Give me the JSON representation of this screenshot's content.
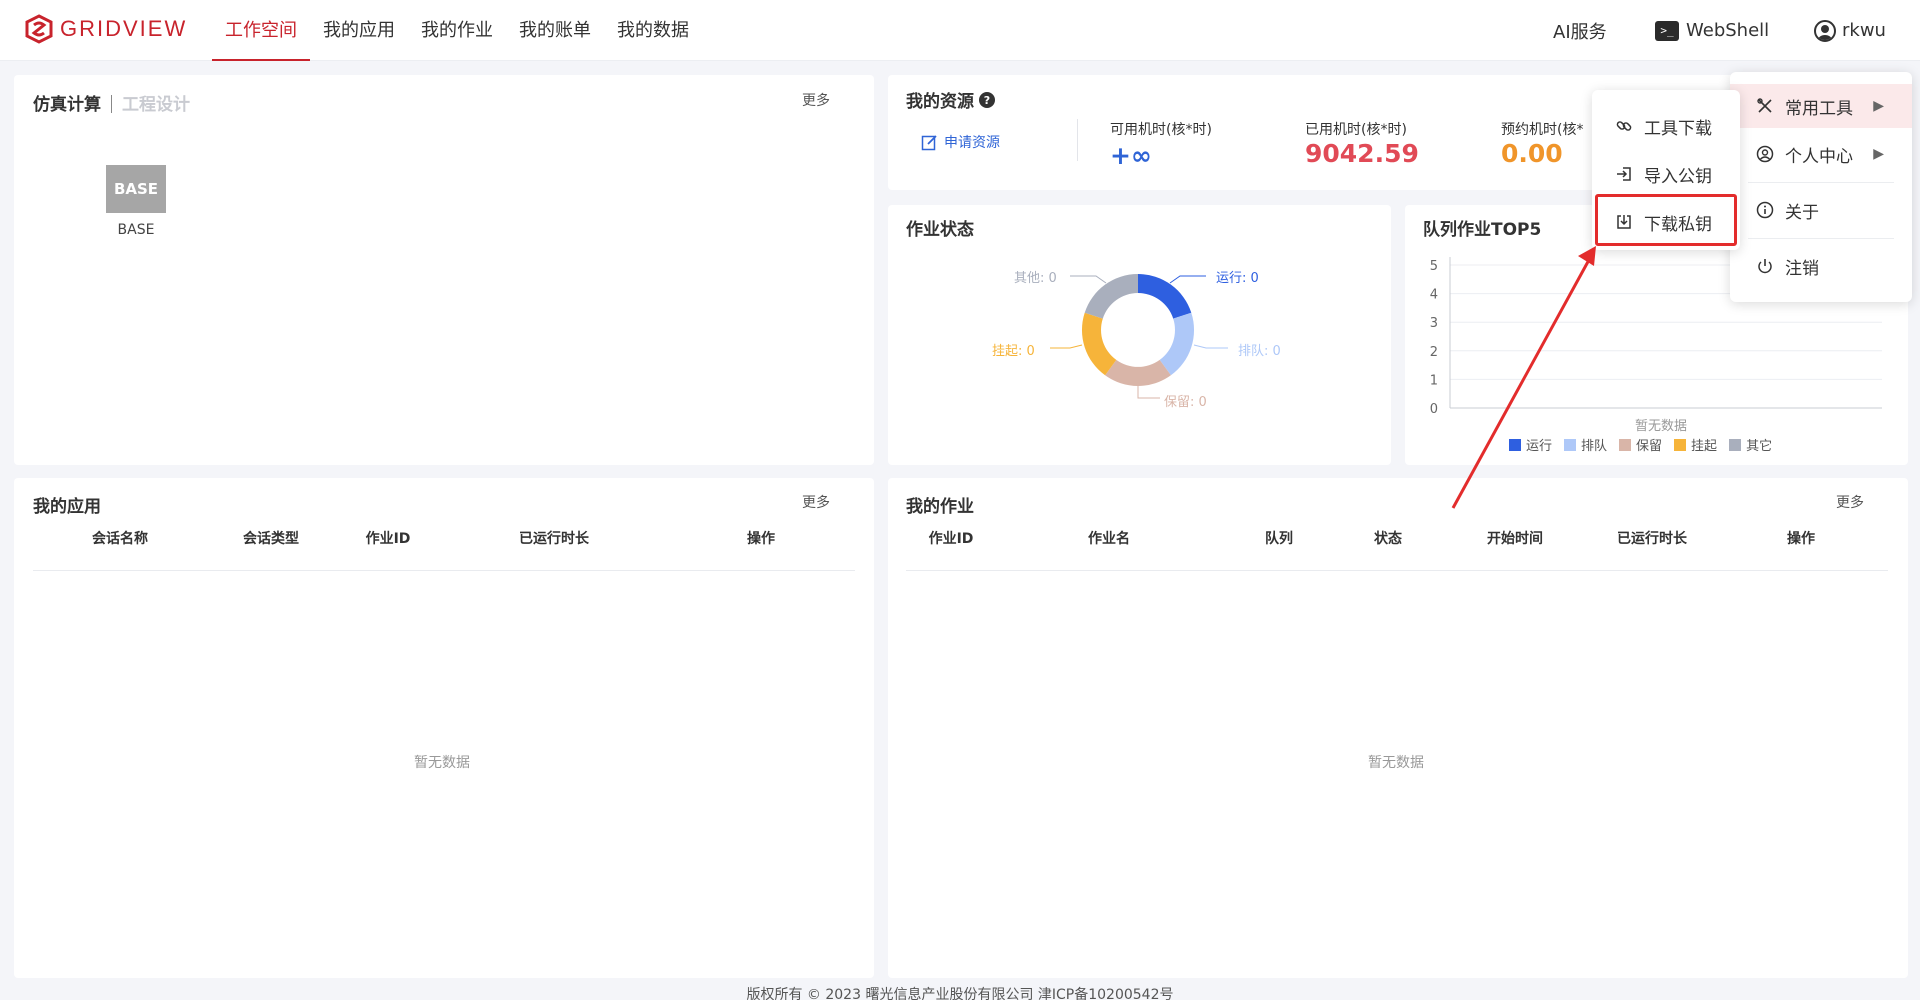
{
  "header": {
    "logo_text": "GRIDVIEW",
    "nav": [
      {
        "label": "工作空间",
        "active": true
      },
      {
        "label": "我的应用",
        "active": false
      },
      {
        "label": "我的作业",
        "active": false
      },
      {
        "label": "我的账单",
        "active": false
      },
      {
        "label": "我的数据",
        "active": false
      }
    ],
    "ai_service": "AI服务",
    "webshell": "WebShell",
    "username": "rkwu"
  },
  "sim_card": {
    "tab_active": "仿真计算",
    "tab_inactive": "工程设计",
    "more": "更多",
    "app_tile": "BASE",
    "app_label": "BASE"
  },
  "resources": {
    "title": "我的资源",
    "apply": "申请资源",
    "available_label": "可用机时(核*时)",
    "available_value": "+∞",
    "used_label": "已用机时(核*时)",
    "used_value": "9042.59",
    "reserved_label": "预约机时(核*",
    "reserved_value": "0.00"
  },
  "job_status": {
    "title": "作业状态",
    "labels": {
      "running": "运行: 0",
      "queued": "排队: 0",
      "held": "保留: 0",
      "suspended": "挂起: 0",
      "other": "其他: 0"
    }
  },
  "queue_top5": {
    "title": "队列作业TOP5",
    "empty": "暂无数据"
  },
  "chart_data": {
    "type": "bar",
    "title": "队列作业TOP5",
    "categories": [],
    "series": [
      {
        "name": "运行",
        "values": []
      },
      {
        "name": "排队",
        "values": []
      },
      {
        "name": "保留",
        "values": []
      },
      {
        "name": "挂起",
        "values": []
      },
      {
        "name": "其它",
        "values": []
      }
    ],
    "yticks": [
      "0",
      "1",
      "2",
      "3",
      "4",
      "5"
    ],
    "ylim": [
      0,
      5
    ],
    "grid": true,
    "legend": "bottom",
    "colors": [
      "#2e5fe0",
      "#aec8f8",
      "#d9b5a8",
      "#f6b43a",
      "#a9afbd"
    ]
  },
  "my_apps": {
    "title": "我的应用",
    "more": "更多",
    "columns": [
      "会话名称",
      "会话类型",
      "作业ID",
      "已运行时长",
      "操作"
    ],
    "empty": "暂无数据"
  },
  "my_jobs": {
    "title": "我的作业",
    "more": "更多",
    "columns": [
      "作业ID",
      "作业名",
      "队列",
      "状态",
      "开始时间",
      "已运行时长",
      "操作"
    ],
    "empty": "暂无数据"
  },
  "submenu": {
    "items": [
      "工具下载",
      "导入公钥",
      "下载私钥"
    ]
  },
  "user_menu": {
    "items": [
      "常用工具",
      "个人中心",
      "关于",
      "注销"
    ]
  },
  "footer": "版权所有 © 2023 曙光信息产业股份有限公司 津ICP备10200542号",
  "colors": {
    "brand": "#c8232c",
    "running": "#2e5fe0",
    "queued": "#aec8f8",
    "held": "#d9b5a8",
    "suspended": "#f6b43a",
    "other": "#a9afbd",
    "used_value": "#e14a56",
    "reserved_value": "#f0952a"
  }
}
